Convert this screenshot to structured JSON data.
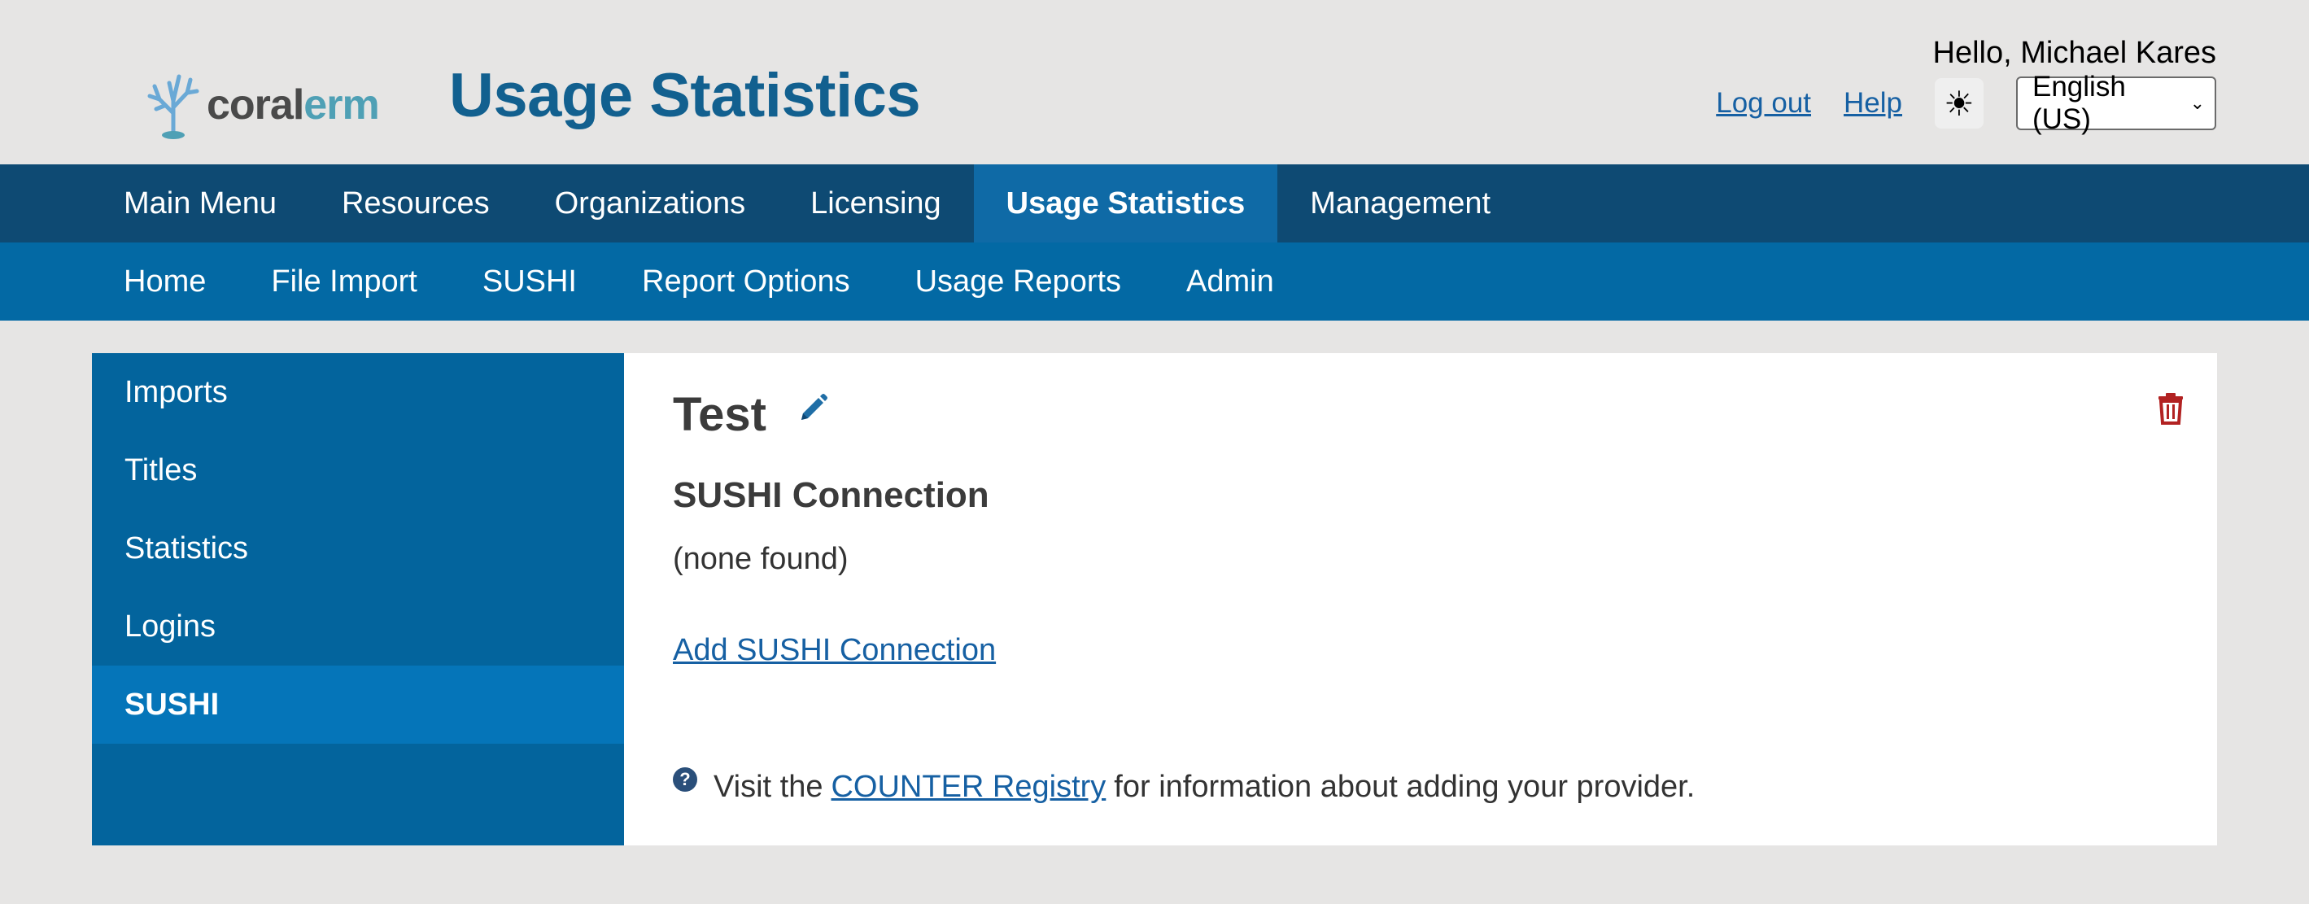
{
  "header": {
    "logo_coral": "coral",
    "logo_erm": "erm",
    "app_title": "Usage Statistics",
    "greeting": "Hello, Michael Kares",
    "logout_label": "Log out",
    "help_label": "Help",
    "theme_icon": "sun-icon",
    "language_selected": "English (US)"
  },
  "main_nav": {
    "items": [
      {
        "label": "Main Menu"
      },
      {
        "label": "Resources"
      },
      {
        "label": "Organizations"
      },
      {
        "label": "Licensing"
      },
      {
        "label": "Usage Statistics",
        "active": true
      },
      {
        "label": "Management"
      }
    ]
  },
  "sub_nav": {
    "items": [
      {
        "label": "Home"
      },
      {
        "label": "File Import"
      },
      {
        "label": "SUSHI"
      },
      {
        "label": "Report Options"
      },
      {
        "label": "Usage Reports"
      },
      {
        "label": "Admin"
      }
    ]
  },
  "sidebar": {
    "items": [
      {
        "label": "Imports"
      },
      {
        "label": "Titles"
      },
      {
        "label": "Statistics"
      },
      {
        "label": "Logins"
      },
      {
        "label": "SUSHI",
        "active": true
      }
    ]
  },
  "content": {
    "title": "Test",
    "section_title": "SUSHI Connection",
    "none_found": "(none found)",
    "add_link": "Add SUSHI Connection",
    "info_prefix": "Visit the",
    "info_link": "COUNTER Registry",
    "info_suffix": "for information about adding your provider.",
    "info_icon_glyph": "?"
  },
  "colors": {
    "brand_blue": "#12608f",
    "main_nav_bg": "#0e4a73",
    "sub_nav_bg": "#0369a4",
    "link": "#1660a3",
    "delete": "#b22222"
  }
}
